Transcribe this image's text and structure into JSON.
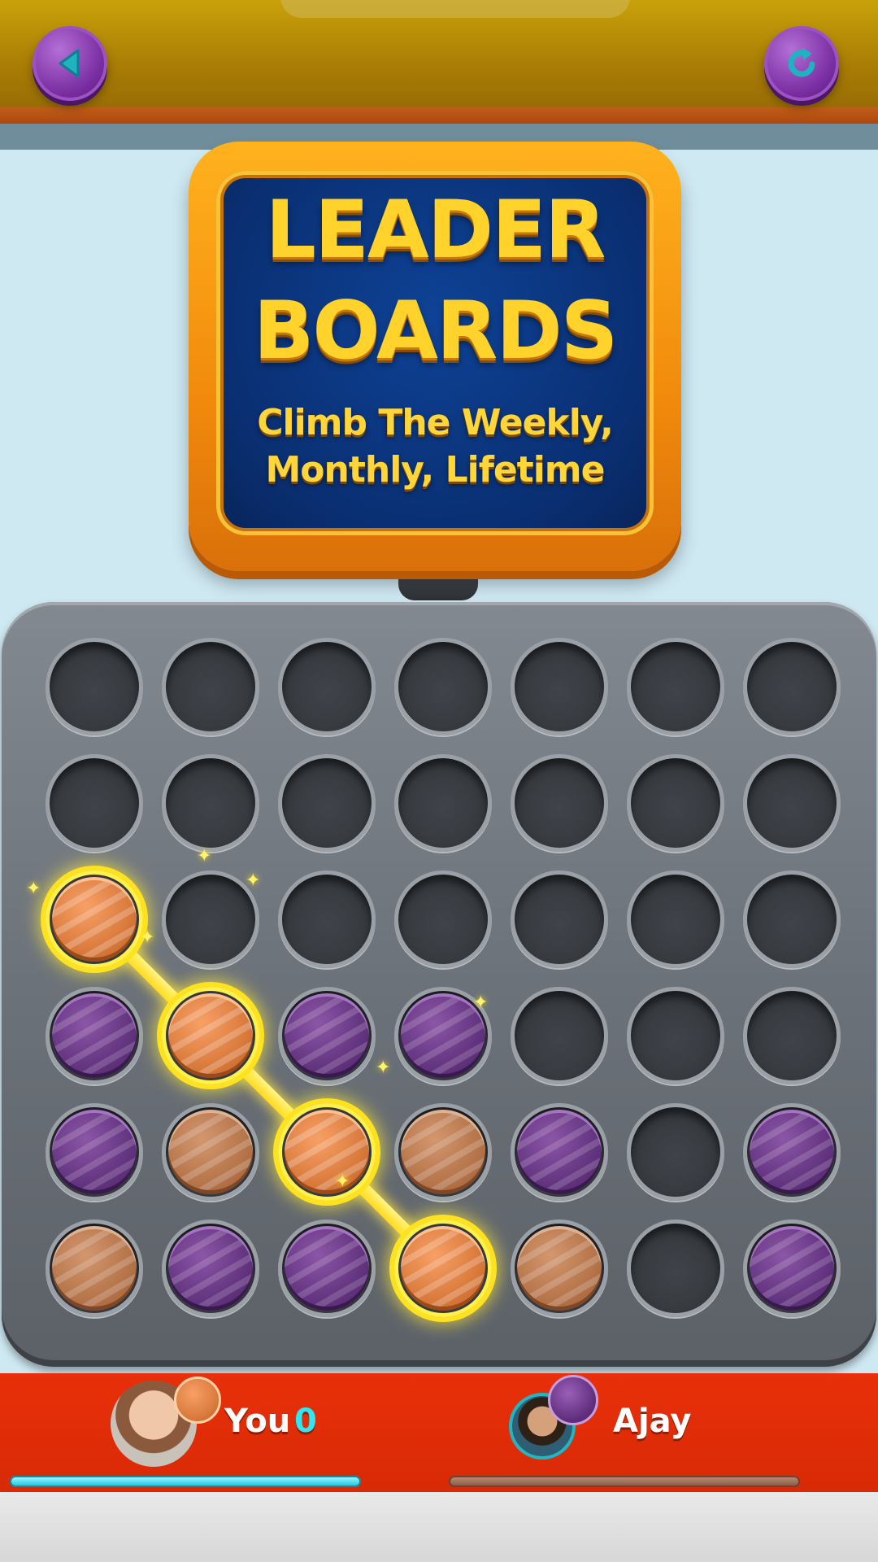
{
  "header": {
    "back_icon": "back-arrow-icon",
    "reload_icon": "reload-icon",
    "button_color": "#7b2fa3",
    "icon_color": "#1fb3c2"
  },
  "sign": {
    "title_line_1": "LEADER",
    "title_line_2": "BOARDS",
    "subtitle_line_1": "Climb The Weekly,",
    "subtitle_line_2": "Monthly, Lifetime"
  },
  "board": {
    "columns": 7,
    "rows": 6,
    "grid": [
      [
        ".",
        ".",
        ".",
        ".",
        ".",
        ".",
        "."
      ],
      [
        ".",
        ".",
        ".",
        ".",
        ".",
        ".",
        "."
      ],
      [
        "O",
        ".",
        ".",
        ".",
        ".",
        ".",
        "."
      ],
      [
        "P",
        "O",
        "P",
        "P",
        ".",
        ".",
        "."
      ],
      [
        "P",
        "O",
        "O",
        "O",
        "P",
        ".",
        "P"
      ],
      [
        "O",
        "P",
        "P",
        "O",
        "O",
        ".",
        "P"
      ]
    ],
    "winning_cells": [
      [
        2,
        0
      ],
      [
        3,
        1
      ],
      [
        4,
        2
      ],
      [
        5,
        3
      ]
    ],
    "colors": {
      "orange": "#d97a3c",
      "purple": "#633480",
      "highlight": "#ffe21f"
    }
  },
  "players": {
    "you": {
      "name": "You",
      "score": "0",
      "disc": "orange",
      "progress": 1.0
    },
    "opponent": {
      "name": "Ajay",
      "disc": "purple",
      "progress": 1.0
    }
  }
}
